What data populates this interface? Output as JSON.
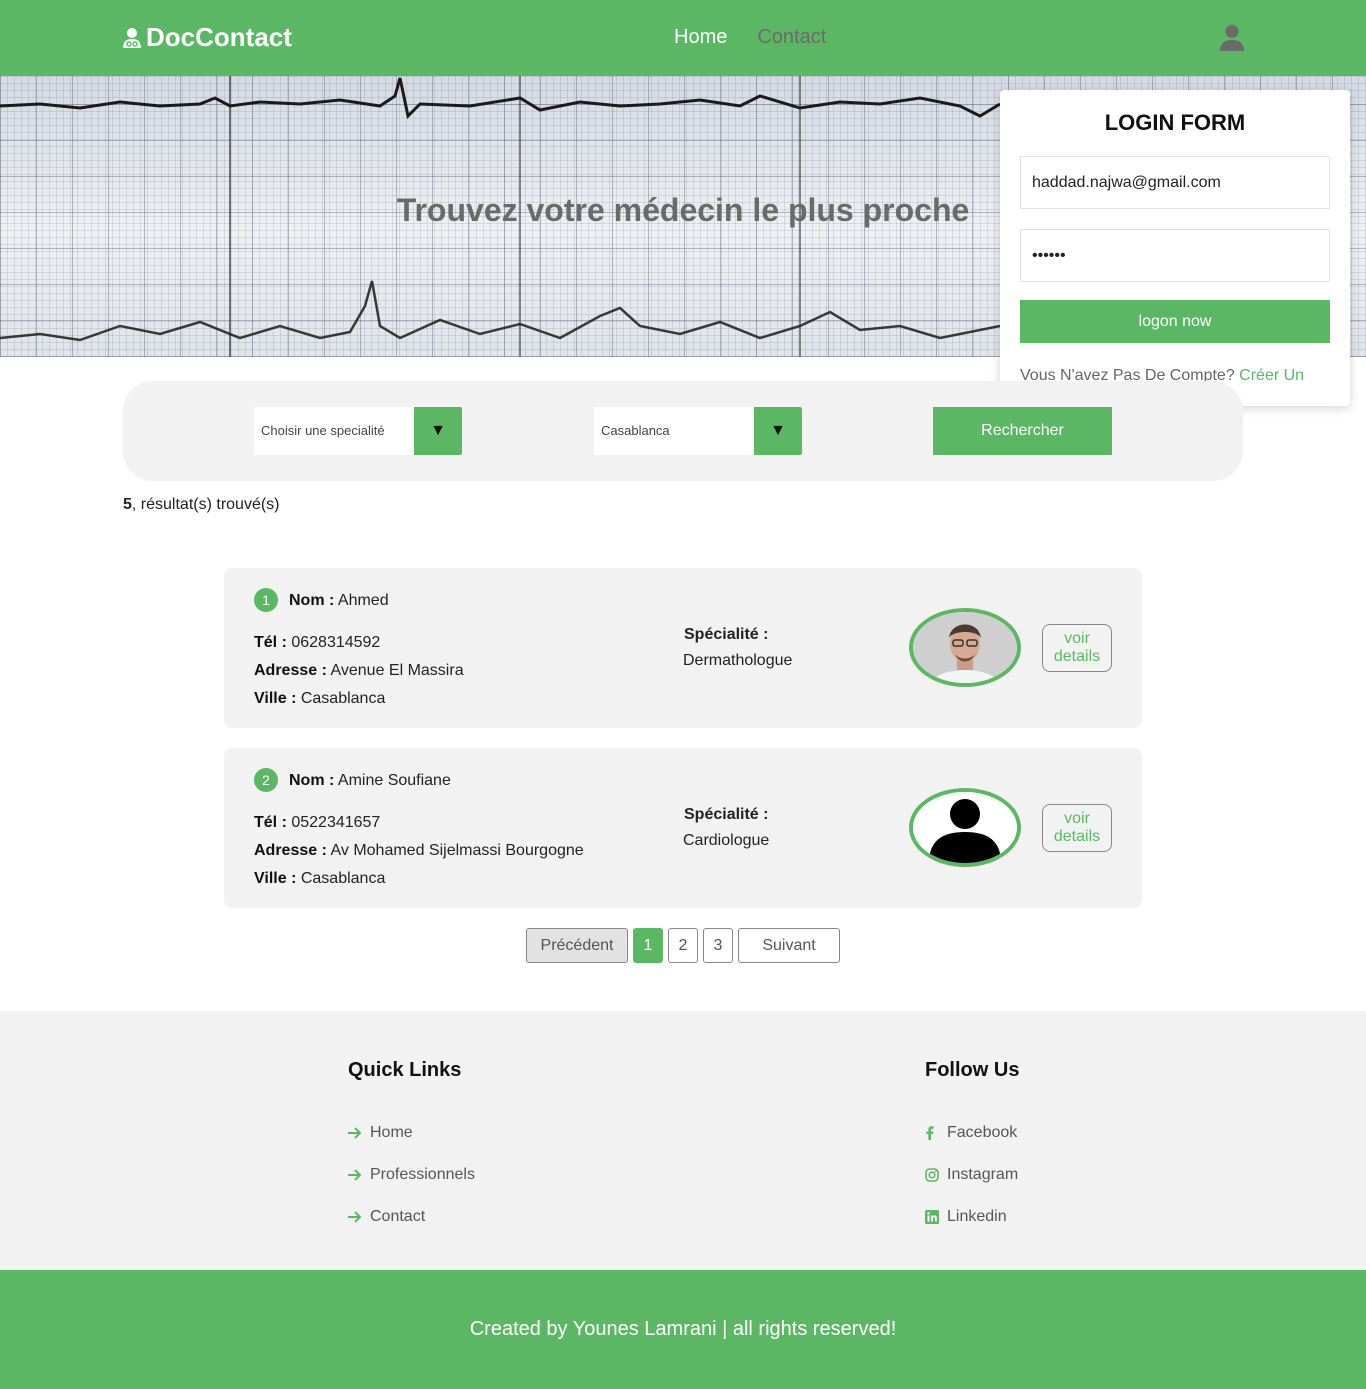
{
  "header": {
    "brand": "DocContact",
    "nav": {
      "home": "Home",
      "contact": "Contact"
    },
    "colors": {
      "primary": "#5cb765",
      "nav_inactive": "#6b6b6b"
    }
  },
  "hero": {
    "title": "Trouvez votre médecin le plus proche"
  },
  "login": {
    "title": "LOGIN FORM",
    "email_value": "haddad.najwa@gmail.com",
    "password_value": "••••••",
    "submit": "logon now",
    "signup_prompt": "Vous N'avez Pas De Compte?",
    "signup_link": "Créer Un"
  },
  "search": {
    "specialite_value": "Choisir une specialité",
    "ville_value": "Casablanca",
    "button": "Rechercher",
    "arrow": "▼"
  },
  "results": {
    "count": "5",
    "text": ", résultat(s) trouvé(s)"
  },
  "labels": {
    "nom": "Nom :",
    "tel": "Tél :",
    "adresse": "Adresse :",
    "ville": "Ville :",
    "specialite": "Spécialité :",
    "voir": "voir",
    "details": "details"
  },
  "doctors": [
    {
      "index": "1",
      "nom": "Ahmed",
      "tel": "0628314592",
      "adresse": "Avenue El Massira",
      "ville": "Casablanca",
      "specialite": "Dermathologue",
      "avatar": "photo"
    },
    {
      "index": "2",
      "nom": "Amine Soufiane",
      "tel": "0522341657",
      "adresse": "Av Mohamed Sijelmassi Bourgogne",
      "ville": "Casablanca",
      "specialite": "Cardiologue",
      "avatar": "default-user-icon"
    }
  ],
  "pagination": {
    "prev": "Précédent",
    "pages": [
      "1",
      "2",
      "3"
    ],
    "next": "Suivant",
    "current": "1"
  },
  "footer": {
    "quick_links_title": "Quick Links",
    "quick_links": [
      "Home",
      "Professionnels",
      "Contact"
    ],
    "follow_title": "Follow Us",
    "follow": [
      {
        "label": "Facebook",
        "icon": "facebook-icon"
      },
      {
        "label": "Instagram",
        "icon": "instagram-icon"
      },
      {
        "label": "Linkedin",
        "icon": "linkedin-icon"
      }
    ],
    "copyright": "Created by Younes Lamrani | all rights reserved!"
  }
}
